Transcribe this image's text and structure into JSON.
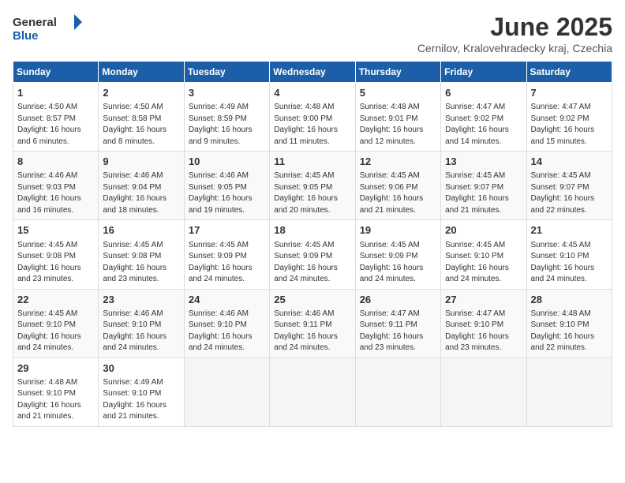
{
  "header": {
    "logo_general": "General",
    "logo_blue": "Blue",
    "month_title": "June 2025",
    "location": "Cernilov, Kralovehradecky kraj, Czechia"
  },
  "weekdays": [
    "Sunday",
    "Monday",
    "Tuesday",
    "Wednesday",
    "Thursday",
    "Friday",
    "Saturday"
  ],
  "weeks": [
    [
      {
        "day": "1",
        "sunrise": "4:50 AM",
        "sunset": "8:57 PM",
        "daylight": "16 hours and 6 minutes."
      },
      {
        "day": "2",
        "sunrise": "4:50 AM",
        "sunset": "8:58 PM",
        "daylight": "16 hours and 8 minutes."
      },
      {
        "day": "3",
        "sunrise": "4:49 AM",
        "sunset": "8:59 PM",
        "daylight": "16 hours and 9 minutes."
      },
      {
        "day": "4",
        "sunrise": "4:48 AM",
        "sunset": "9:00 PM",
        "daylight": "16 hours and 11 minutes."
      },
      {
        "day": "5",
        "sunrise": "4:48 AM",
        "sunset": "9:01 PM",
        "daylight": "16 hours and 12 minutes."
      },
      {
        "day": "6",
        "sunrise": "4:47 AM",
        "sunset": "9:02 PM",
        "daylight": "16 hours and 14 minutes."
      },
      {
        "day": "7",
        "sunrise": "4:47 AM",
        "sunset": "9:02 PM",
        "daylight": "16 hours and 15 minutes."
      }
    ],
    [
      {
        "day": "8",
        "sunrise": "4:46 AM",
        "sunset": "9:03 PM",
        "daylight": "16 hours and 16 minutes."
      },
      {
        "day": "9",
        "sunrise": "4:46 AM",
        "sunset": "9:04 PM",
        "daylight": "16 hours and 18 minutes."
      },
      {
        "day": "10",
        "sunrise": "4:46 AM",
        "sunset": "9:05 PM",
        "daylight": "16 hours and 19 minutes."
      },
      {
        "day": "11",
        "sunrise": "4:45 AM",
        "sunset": "9:05 PM",
        "daylight": "16 hours and 20 minutes."
      },
      {
        "day": "12",
        "sunrise": "4:45 AM",
        "sunset": "9:06 PM",
        "daylight": "16 hours and 21 minutes."
      },
      {
        "day": "13",
        "sunrise": "4:45 AM",
        "sunset": "9:07 PM",
        "daylight": "16 hours and 21 minutes."
      },
      {
        "day": "14",
        "sunrise": "4:45 AM",
        "sunset": "9:07 PM",
        "daylight": "16 hours and 22 minutes."
      }
    ],
    [
      {
        "day": "15",
        "sunrise": "4:45 AM",
        "sunset": "9:08 PM",
        "daylight": "16 hours and 23 minutes."
      },
      {
        "day": "16",
        "sunrise": "4:45 AM",
        "sunset": "9:08 PM",
        "daylight": "16 hours and 23 minutes."
      },
      {
        "day": "17",
        "sunrise": "4:45 AM",
        "sunset": "9:09 PM",
        "daylight": "16 hours and 24 minutes."
      },
      {
        "day": "18",
        "sunrise": "4:45 AM",
        "sunset": "9:09 PM",
        "daylight": "16 hours and 24 minutes."
      },
      {
        "day": "19",
        "sunrise": "4:45 AM",
        "sunset": "9:09 PM",
        "daylight": "16 hours and 24 minutes."
      },
      {
        "day": "20",
        "sunrise": "4:45 AM",
        "sunset": "9:10 PM",
        "daylight": "16 hours and 24 minutes."
      },
      {
        "day": "21",
        "sunrise": "4:45 AM",
        "sunset": "9:10 PM",
        "daylight": "16 hours and 24 minutes."
      }
    ],
    [
      {
        "day": "22",
        "sunrise": "4:45 AM",
        "sunset": "9:10 PM",
        "daylight": "16 hours and 24 minutes."
      },
      {
        "day": "23",
        "sunrise": "4:46 AM",
        "sunset": "9:10 PM",
        "daylight": "16 hours and 24 minutes."
      },
      {
        "day": "24",
        "sunrise": "4:46 AM",
        "sunset": "9:10 PM",
        "daylight": "16 hours and 24 minutes."
      },
      {
        "day": "25",
        "sunrise": "4:46 AM",
        "sunset": "9:11 PM",
        "daylight": "16 hours and 24 minutes."
      },
      {
        "day": "26",
        "sunrise": "4:47 AM",
        "sunset": "9:11 PM",
        "daylight": "16 hours and 23 minutes."
      },
      {
        "day": "27",
        "sunrise": "4:47 AM",
        "sunset": "9:10 PM",
        "daylight": "16 hours and 23 minutes."
      },
      {
        "day": "28",
        "sunrise": "4:48 AM",
        "sunset": "9:10 PM",
        "daylight": "16 hours and 22 minutes."
      }
    ],
    [
      {
        "day": "29",
        "sunrise": "4:48 AM",
        "sunset": "9:10 PM",
        "daylight": "16 hours and 21 minutes."
      },
      {
        "day": "30",
        "sunrise": "4:49 AM",
        "sunset": "9:10 PM",
        "daylight": "16 hours and 21 minutes."
      },
      null,
      null,
      null,
      null,
      null
    ]
  ],
  "labels": {
    "sunrise": "Sunrise: ",
    "sunset": "Sunset: ",
    "daylight": "Daylight: "
  }
}
